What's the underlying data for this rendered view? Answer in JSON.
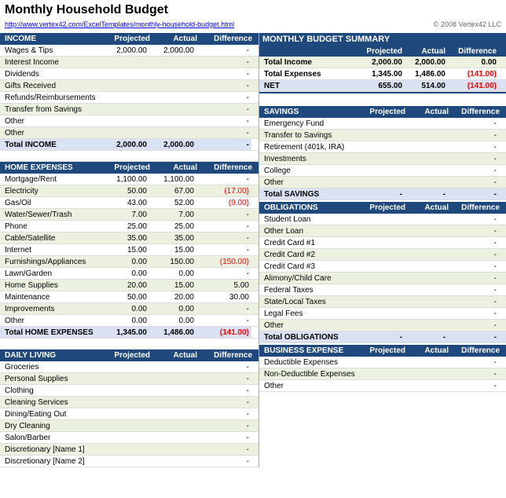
{
  "title": "Monthly Household Budget",
  "link": "http://www.vertex42.com/ExcelTemplates/monthly-household-budget.html",
  "copyright": "© 2008 Vertex42 LLC",
  "columns": {
    "projected": "Projected",
    "actual": "Actual",
    "difference": "Difference"
  },
  "income": {
    "header": "INCOME",
    "rows": [
      {
        "label": "Wages & Tips",
        "projected": "2,000.00",
        "actual": "2,000.00",
        "difference": "-"
      },
      {
        "label": "Interest Income",
        "projected": "",
        "actual": "",
        "difference": "-"
      },
      {
        "label": "Dividends",
        "projected": "",
        "actual": "",
        "difference": "-"
      },
      {
        "label": "Gifts Received",
        "projected": "",
        "actual": "",
        "difference": "-"
      },
      {
        "label": "Refunds/Reimbursements",
        "projected": "",
        "actual": "",
        "difference": "-"
      },
      {
        "label": "Transfer from Savings",
        "projected": "",
        "actual": "",
        "difference": "-"
      },
      {
        "label": "Other",
        "projected": "",
        "actual": "",
        "difference": "-"
      },
      {
        "label": "Other",
        "projected": "",
        "actual": "",
        "difference": "-"
      }
    ],
    "total_label": "Total INCOME",
    "total_projected": "2,000.00",
    "total_actual": "2,000.00",
    "total_diff": "-"
  },
  "home": {
    "header": "HOME EXPENSES",
    "rows": [
      {
        "label": "Mortgage/Rent",
        "projected": "1,100.00",
        "actual": "1,100.00",
        "difference": "-"
      },
      {
        "label": "Electricity",
        "projected": "50.00",
        "actual": "67.00",
        "difference": "(17.00)",
        "neg": true
      },
      {
        "label": "Gas/Oil",
        "projected": "43.00",
        "actual": "52.00",
        "difference": "(9.00)",
        "neg": true
      },
      {
        "label": "Water/Sewer/Trash",
        "projected": "7.00",
        "actual": "7.00",
        "difference": "-"
      },
      {
        "label": "Phone",
        "projected": "25.00",
        "actual": "25.00",
        "difference": "-"
      },
      {
        "label": "Cable/Satellite",
        "projected": "35.00",
        "actual": "35.00",
        "difference": "-"
      },
      {
        "label": "Internet",
        "projected": "15.00",
        "actual": "15.00",
        "difference": "-"
      },
      {
        "label": "Furnishings/Appliances",
        "projected": "0.00",
        "actual": "150.00",
        "difference": "(150.00)",
        "neg": true
      },
      {
        "label": "Lawn/Garden",
        "projected": "0.00",
        "actual": "0.00",
        "difference": "-"
      },
      {
        "label": "Home Supplies",
        "projected": "20.00",
        "actual": "15.00",
        "difference": "5.00"
      },
      {
        "label": "Maintenance",
        "projected": "50.00",
        "actual": "20.00",
        "difference": "30.00"
      },
      {
        "label": "Improvements",
        "projected": "0.00",
        "actual": "0.00",
        "difference": "-"
      },
      {
        "label": "Other",
        "projected": "0.00",
        "actual": "0.00",
        "difference": "-"
      }
    ],
    "total_label": "Total HOME EXPENSES",
    "total_projected": "1,345.00",
    "total_actual": "1,486.00",
    "total_diff": "(141.00)",
    "total_neg": true
  },
  "daily": {
    "header": "DAILY LIVING",
    "rows": [
      {
        "label": "Groceries",
        "projected": "",
        "actual": "",
        "difference": "-"
      },
      {
        "label": "Personal Supplies",
        "projected": "",
        "actual": "",
        "difference": "-"
      },
      {
        "label": "Clothing",
        "projected": "",
        "actual": "",
        "difference": "-"
      },
      {
        "label": "Cleaning Services",
        "projected": "",
        "actual": "",
        "difference": "-"
      },
      {
        "label": "Dining/Eating Out",
        "projected": "",
        "actual": "",
        "difference": "-"
      },
      {
        "label": "Dry Cleaning",
        "projected": "",
        "actual": "",
        "difference": "-"
      },
      {
        "label": "Salon/Barber",
        "projected": "",
        "actual": "",
        "difference": "-"
      },
      {
        "label": "Discretionary [Name 1]",
        "projected": "",
        "actual": "",
        "difference": "-"
      },
      {
        "label": "Discretionary [Name 2]",
        "projected": "",
        "actual": "",
        "difference": "-"
      }
    ]
  },
  "summary": {
    "title": "MONTHLY BUDGET SUMMARY",
    "rows": [
      {
        "label": "Total Income",
        "projected": "2,000.00",
        "actual": "2,000.00",
        "difference": "0.00"
      },
      {
        "label": "Total Expenses",
        "projected": "1,345.00",
        "actual": "1,486.00",
        "difference": "(141.00)",
        "neg": true
      },
      {
        "label": "NET",
        "projected": "655.00",
        "actual": "514.00",
        "difference": "(141.00)",
        "neg": true,
        "net": true
      }
    ]
  },
  "savings": {
    "header": "SAVINGS",
    "rows": [
      {
        "label": "Emergency Fund",
        "projected": "",
        "actual": "",
        "difference": "-"
      },
      {
        "label": "Transfer to Savings",
        "projected": "",
        "actual": "",
        "difference": "-"
      },
      {
        "label": "Retirement (401k, IRA)",
        "projected": "",
        "actual": "",
        "difference": "-"
      },
      {
        "label": "Investments",
        "projected": "",
        "actual": "",
        "difference": "-"
      },
      {
        "label": "College",
        "projected": "",
        "actual": "",
        "difference": "-"
      },
      {
        "label": "Other",
        "projected": "",
        "actual": "",
        "difference": "-"
      }
    ],
    "total_label": "Total SAVINGS",
    "total_projected": "-",
    "total_actual": "-",
    "total_diff": "-"
  },
  "obligations": {
    "header": "OBLIGATIONS",
    "rows": [
      {
        "label": "Student Loan",
        "projected": "",
        "actual": "",
        "difference": "-"
      },
      {
        "label": "Other Loan",
        "projected": "",
        "actual": "",
        "difference": "-"
      },
      {
        "label": "Credit Card #1",
        "projected": "",
        "actual": "",
        "difference": "-"
      },
      {
        "label": "Credit Card #2",
        "projected": "",
        "actual": "",
        "difference": "-"
      },
      {
        "label": "Credit Card #3",
        "projected": "",
        "actual": "",
        "difference": "-"
      },
      {
        "label": "Alimony/Child Care",
        "projected": "",
        "actual": "",
        "difference": "-"
      },
      {
        "label": "Federal Taxes",
        "projected": "",
        "actual": "",
        "difference": "-"
      },
      {
        "label": "State/Local Taxes",
        "projected": "",
        "actual": "",
        "difference": "-"
      },
      {
        "label": "Legal Fees",
        "projected": "",
        "actual": "",
        "difference": "-"
      },
      {
        "label": "Other",
        "projected": "",
        "actual": "",
        "difference": "-"
      }
    ],
    "total_label": "Total OBLIGATIONS",
    "total_projected": "-",
    "total_actual": "-",
    "total_diff": "-"
  },
  "business": {
    "header": "BUSINESS EXPENSE",
    "rows": [
      {
        "label": "Deductible Expenses",
        "projected": "",
        "actual": "",
        "difference": "-"
      },
      {
        "label": "Non-Deductible Expenses",
        "projected": "",
        "actual": "",
        "difference": "-"
      },
      {
        "label": "Other",
        "projected": "",
        "actual": "",
        "difference": "-"
      }
    ]
  }
}
